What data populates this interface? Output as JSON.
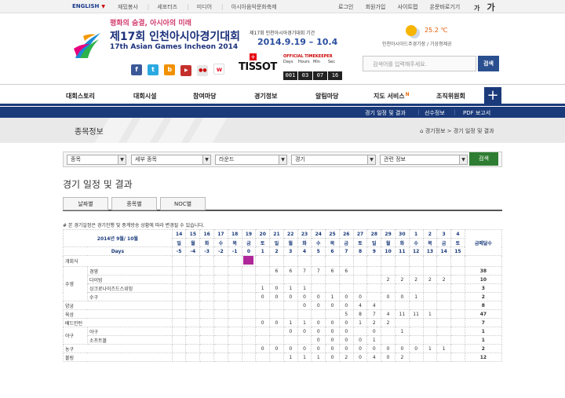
{
  "topbar": {
    "english": "ENGLISH",
    "links": [
      "재밌봉사",
      "세포터즈",
      "미디어",
      "아시아음악문화축제"
    ],
    "util": [
      "로그인",
      "회원가입",
      "사이트맵",
      "온문바로기기"
    ],
    "font_small": "가",
    "font_large": "가"
  },
  "header": {
    "slogan": "평화의 숨결, 아시아의 미래",
    "title_ko": "제17회 인천아시아경기대회",
    "title_en": "17th Asian Games Incheon 2014",
    "period_label": "제17회 인천아시아경기대회 기간",
    "period": "2014.9.19 – 10.4",
    "timekeeper": {
      "brand": "TISSOT",
      "official": "OFFICIAL TIMEKEEPER",
      "units": [
        "Days",
        "Hours",
        "Min",
        "Sec"
      ],
      "digits": [
        "001",
        "03",
        "07",
        "16"
      ]
    },
    "weather": {
      "temp": "25.2 ℃",
      "location": "인천아시아드주경기장 / 기상청제공"
    },
    "search_placeholder": "검색어를 입력해주세요.",
    "search_button": "검색"
  },
  "gnb": [
    "대회스토리",
    "대회시설",
    "참여마당",
    "경기정보",
    "알림마당",
    "지도 서비스",
    "조직위원회"
  ],
  "subnav": [
    "경기 일정 및 결과",
    "선수정보",
    "PDF 보고서"
  ],
  "page": {
    "banner_title": "종목정보",
    "breadcrumb": "경기정보 > 경기 일정 및 결과",
    "filters": [
      "종목",
      "세부 종목",
      "라운드",
      "경기",
      "관련 정보"
    ],
    "search_button": "검색",
    "heading": "경기 일정 및 결과",
    "tabs": [
      "날짜별",
      "종목별",
      "NOC별"
    ],
    "note": "# 본 경기일정은 경기진행 및 중계방송 상황에 따라 변경될 수 있습니다."
  },
  "schedule": {
    "month_label": "2014년 9월/ 10월",
    "days_label": "Days",
    "medal_label": "금메달수",
    "dates": [
      "14",
      "15",
      "16",
      "17",
      "18",
      "19",
      "20",
      "21",
      "22",
      "23",
      "24",
      "25",
      "26",
      "27",
      "28",
      "29",
      "30",
      "1",
      "2",
      "3",
      "4"
    ],
    "weekdays": [
      "일",
      "월",
      "화",
      "수",
      "목",
      "금",
      "토",
      "일",
      "월",
      "화",
      "수",
      "목",
      "금",
      "토",
      "일",
      "월",
      "화",
      "수",
      "목",
      "금",
      "토"
    ],
    "day_nums": [
      "-5",
      "-4",
      "-3",
      "-2",
      "-1",
      "0",
      "1",
      "2",
      "3",
      "4",
      "5",
      "6",
      "7",
      "8",
      "9",
      "10",
      "11",
      "12",
      "13",
      "14",
      "15"
    ],
    "rows": [
      {
        "sport": "개회식",
        "disc": "",
        "cells": [
          "",
          "",
          "",
          "",
          "",
          "O",
          "",
          "",
          "",
          "",
          "",
          "",
          "",
          "",
          "",
          "",
          "",
          "",
          "",
          "",
          ""
        ],
        "medal": ""
      },
      {
        "sport": "수영",
        "disc": "경영",
        "cells": [
          "",
          "",
          "",
          "",
          "",
          "",
          "",
          "6",
          "6",
          "7",
          "7",
          "6",
          "6",
          "",
          "",
          "",
          "",
          "",
          "",
          "",
          ""
        ],
        "medal": "38"
      },
      {
        "sport": "",
        "disc": "다이빙",
        "cells": [
          "",
          "",
          "",
          "",
          "",
          "",
          "",
          "",
          "",
          "",
          "",
          "",
          "",
          "",
          "",
          "2",
          "2",
          "2",
          "2",
          "2",
          ""
        ],
        "medal": "10"
      },
      {
        "sport": "",
        "disc": "싱크로나이즈드스위밍",
        "cells": [
          "",
          "",
          "",
          "",
          "",
          "",
          "1",
          "0",
          "1",
          "1",
          "",
          "",
          "",
          "",
          "",
          "",
          "",
          "",
          "",
          "",
          ""
        ],
        "medal": "3"
      },
      {
        "sport": "",
        "disc": "수구",
        "cells": [
          "",
          "",
          "",
          "",
          "",
          "",
          "0",
          "0",
          "0",
          "0",
          "0",
          "1",
          "0",
          "0",
          "",
          "0",
          "0",
          "1",
          "",
          "",
          ""
        ],
        "medal": "2"
      },
      {
        "sport": "양궁",
        "disc": "",
        "cells": [
          "",
          "",
          "",
          "",
          "",
          "",
          "",
          "",
          "",
          "0",
          "0",
          "0",
          "0",
          "4",
          "4",
          "",
          "",
          "",
          "",
          "",
          ""
        ],
        "medal": "8"
      },
      {
        "sport": "육상",
        "disc": "",
        "cells": [
          "",
          "",
          "",
          "",
          "",
          "",
          "",
          "",
          "",
          "",
          "",
          "",
          "5",
          "8",
          "7",
          "4",
          "11",
          "11",
          "1",
          "",
          ""
        ],
        "medal": "47"
      },
      {
        "sport": "배드민턴",
        "disc": "",
        "cells": [
          "",
          "",
          "",
          "",
          "",
          "",
          "0",
          "0",
          "1",
          "1",
          "0",
          "0",
          "0",
          "1",
          "2",
          "2",
          "",
          "",
          "",
          "",
          ""
        ],
        "medal": "7"
      },
      {
        "sport": "야구",
        "disc": "야구",
        "cells": [
          "",
          "",
          "",
          "",
          "",
          "",
          "",
          "",
          "0",
          "0",
          "0",
          "0",
          "0",
          "",
          "0",
          "",
          "1",
          "",
          "",
          "",
          ""
        ],
        "medal": "1"
      },
      {
        "sport": "",
        "disc": "소프트볼",
        "cells": [
          "",
          "",
          "",
          "",
          "",
          "",
          "",
          "",
          "",
          "",
          "0",
          "0",
          "0",
          "0",
          "1",
          "",
          "",
          "",
          "",
          "",
          ""
        ],
        "medal": "1"
      },
      {
        "sport": "농구",
        "disc": "",
        "cells": [
          "",
          "",
          "",
          "",
          "",
          "",
          "0",
          "0",
          "0",
          "0",
          "0",
          "0",
          "0",
          "0",
          "0",
          "0",
          "0",
          "0",
          "1",
          "1",
          ""
        ],
        "medal": "2"
      },
      {
        "sport": "볼링",
        "disc": "",
        "cells": [
          "",
          "",
          "",
          "",
          "",
          "",
          "",
          "",
          "1",
          "1",
          "1",
          "0",
          "2",
          "0",
          "4",
          "0",
          "2",
          "",
          "",
          "",
          ""
        ],
        "medal": "12"
      }
    ]
  }
}
